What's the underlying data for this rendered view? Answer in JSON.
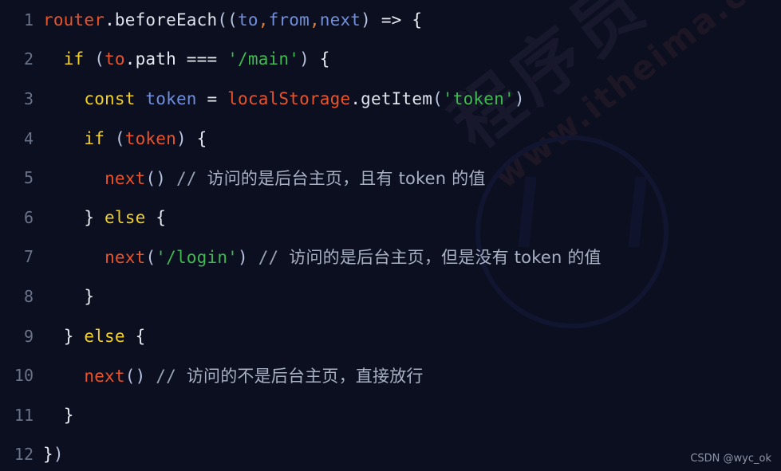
{
  "editor": {
    "background_color": "#0c0f20",
    "line_number_color": "#6a7287",
    "default_text_color": "#dfe3ec",
    "language": "javascript",
    "total_lines": 12
  },
  "colors": {
    "identifier": "#e9532a",
    "keyword": "#f2d024",
    "parameter": "#6f8fdd",
    "string": "#3fb950",
    "comment": "#9aa4b6",
    "punctuation": "#e8eaf2",
    "comma": "#e07c28"
  },
  "lines": [
    {
      "number": "1",
      "text": "router.beforeEach((to, from, next) => {"
    },
    {
      "number": "2",
      "text": "  if (to.path === '/main') {"
    },
    {
      "number": "3",
      "text": "    const token = localStorage.getItem('token')"
    },
    {
      "number": "4",
      "text": "    if (token) {"
    },
    {
      "number": "5",
      "text": "      next() // 访问的是后台主页，且有 token 的值"
    },
    {
      "number": "6",
      "text": "    } else {"
    },
    {
      "number": "7",
      "text": "      next('/login') // 访问的是后台主页，但是没有 token 的值"
    },
    {
      "number": "8",
      "text": "    }"
    },
    {
      "number": "9",
      "text": "  } else {"
    },
    {
      "number": "10",
      "text": "    next() // 访问的不是后台主页，直接放行"
    },
    {
      "number": "11",
      "text": "  }"
    },
    {
      "number": "12",
      "text": "})"
    }
  ],
  "tokens": {
    "l1": {
      "router": "router",
      "dot": ".",
      "beforeEach": "beforeEach",
      "open_parens": "((",
      "to": "to",
      "comma1": ",",
      "from": "from",
      "comma2": ",",
      "next": "next",
      "close_paren": ")",
      "arrow": " => ",
      "brace": "{"
    },
    "l2": {
      "indent": "  ",
      "if": "if",
      "open_paren": " (",
      "to": "to",
      "path": ".path",
      "eq": " === ",
      "string": "'/main'",
      "close_paren": ")",
      "brace": " {"
    },
    "l3": {
      "indent": "    ",
      "const": "const",
      "token": " token",
      "eq": " = ",
      "localStorage": "localStorage",
      "getItem": ".getItem",
      "open_paren": "(",
      "string": "'token'",
      "close_paren": ")"
    },
    "l4": {
      "indent": "    ",
      "if": "if",
      "open_paren": " (",
      "token": "token",
      "close_paren": ")",
      "brace": " {"
    },
    "l5": {
      "indent": "      ",
      "next": "next",
      "parens": "()",
      "comment_slashes": " // ",
      "comment_text": "访问的是后台主页，且有 token 的值"
    },
    "l6": {
      "indent": "    ",
      "close_brace": "}",
      "else": " else",
      "open_brace": " {"
    },
    "l7": {
      "indent": "      ",
      "next": "next",
      "open_paren": "(",
      "string": "'/login'",
      "close_paren": ")",
      "comment_slashes": " // ",
      "comment_text": "访问的是后台主页，但是没有 token 的值"
    },
    "l8": {
      "indent": "    ",
      "close_brace": "}"
    },
    "l9": {
      "indent": "  ",
      "close_brace": "}",
      "else": " else",
      "open_brace": " {"
    },
    "l10": {
      "indent": "    ",
      "next": "next",
      "parens": "()",
      "comment_slashes": " // ",
      "comment_text": "访问的不是后台主页，直接放行"
    },
    "l11": {
      "indent": "  ",
      "close_brace": "}"
    },
    "l12": {
      "close_brace": "}",
      "close_paren": ")"
    }
  },
  "watermark": {
    "credit": "CSDN @wyc_ok",
    "background_cn": "程序员",
    "background_url": "www.itheima.com"
  }
}
